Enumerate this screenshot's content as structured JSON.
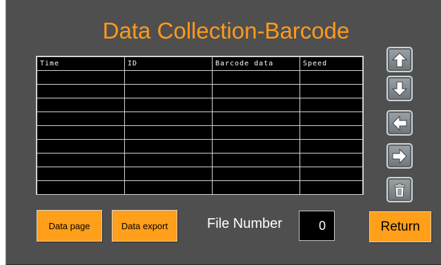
{
  "header": {
    "title": "Data Collection-Barcode"
  },
  "table": {
    "columns": [
      "Time",
      "ID",
      "Barcode data",
      "Speed"
    ],
    "rows": [
      [
        "",
        "",
        "",
        ""
      ],
      [
        "",
        "",
        "",
        ""
      ],
      [
        "",
        "",
        "",
        ""
      ],
      [
        "",
        "",
        "",
        ""
      ],
      [
        "",
        "",
        "",
        ""
      ],
      [
        "",
        "",
        "",
        ""
      ],
      [
        "",
        "",
        "",
        ""
      ],
      [
        "",
        "",
        "",
        ""
      ],
      [
        "",
        "",
        "",
        ""
      ]
    ]
  },
  "nav": {
    "icons": [
      "arrow-up-icon",
      "arrow-down-icon",
      "arrow-left-icon",
      "arrow-right-icon",
      "trash-icon"
    ]
  },
  "footer": {
    "data_page_label": "Data page",
    "data_export_label": "Data export",
    "file_number_label": "File Number",
    "file_number_value": "0",
    "return_label": "Return"
  },
  "colors": {
    "background": "#4f4f4f",
    "accent": "#ff9f1a",
    "title": "#ff9a1c",
    "table_bg": "#000000"
  }
}
